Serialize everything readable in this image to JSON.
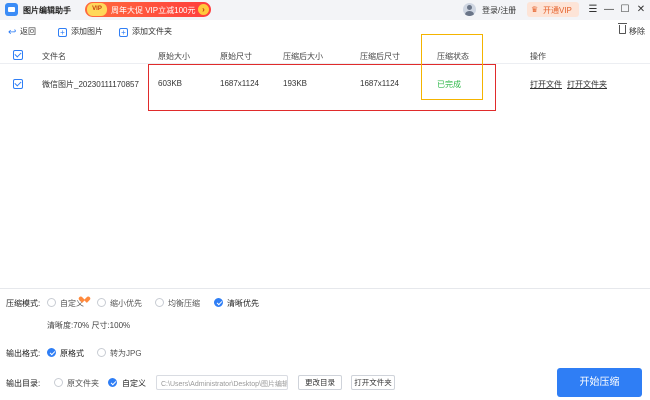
{
  "app": {
    "title": "图片编辑助手",
    "promo_badge": "VIP",
    "promo_text": "周年大促 VIP立减100元",
    "promo_arrow": "›",
    "login": "登录/注册",
    "vip_button": "开通VIP",
    "vip_icon": "♛",
    "window_controls": {
      "menu": "☰",
      "minimize": "—",
      "maximize": "☐",
      "close": "✕"
    }
  },
  "toolbar": {
    "back": "返回",
    "add_image": "添加图片",
    "add_folder": "添加文件夹",
    "remove": "移除"
  },
  "table": {
    "headers": [
      "文件名",
      "原始大小",
      "原始尺寸",
      "压缩后大小",
      "压缩后尺寸",
      "压缩状态",
      "操作"
    ],
    "rows": [
      {
        "filename": "微信图片_20230111170857",
        "orig_size": "603KB",
        "orig_dim": "1687x1124",
        "comp_size": "193KB",
        "comp_dim": "1687x1124",
        "status": "已完成",
        "action_open_file": "打开文件",
        "action_open_folder": "打开文件夹"
      }
    ],
    "status_color": "#2fb84a"
  },
  "compression": {
    "label": "压缩模式:",
    "options": [
      "自定义",
      "缩小优先",
      "均衡压缩",
      "清晰优先"
    ],
    "selected": "清晰优先",
    "info": "清晰度:70%   尺寸:100%"
  },
  "output_format": {
    "label": "输出格式:",
    "options": [
      "原格式",
      "转为JPG"
    ],
    "selected": "原格式"
  },
  "output_dir": {
    "label": "输出目录:",
    "options": [
      "原文件夹",
      "自定义"
    ],
    "selected": "自定义",
    "path": "C:\\Users\\Administrator\\Desktop\\图片编辑",
    "change_btn": "更改目录",
    "open_btn": "打开文件夹"
  },
  "start_button": "开始压缩",
  "colors": {
    "accent": "#2f7ef5",
    "highlight_red": "#e02b2b",
    "highlight_orange": "#f4b400"
  }
}
